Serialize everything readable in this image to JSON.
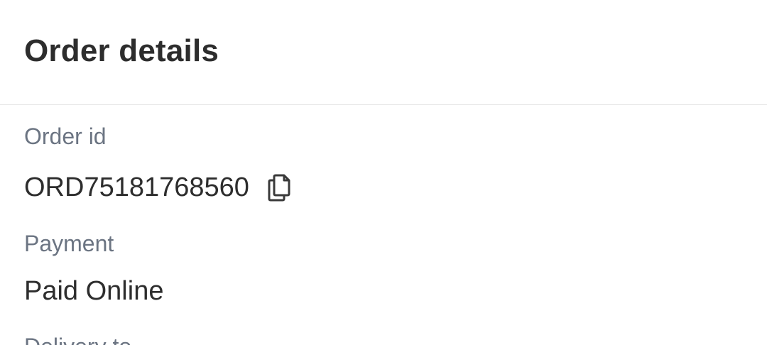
{
  "header": {
    "title": "Order details"
  },
  "order": {
    "id_label": "Order id",
    "id_value": "ORD75181768560",
    "copy_icon": "copy-icon"
  },
  "payment": {
    "label": "Payment",
    "value": "Paid Online"
  },
  "delivery": {
    "label": "Delivery to"
  },
  "colors": {
    "title": "#2d2d2d",
    "label": "#6b7482",
    "value": "#2d2d2d",
    "divider": "#e6e6e6"
  }
}
